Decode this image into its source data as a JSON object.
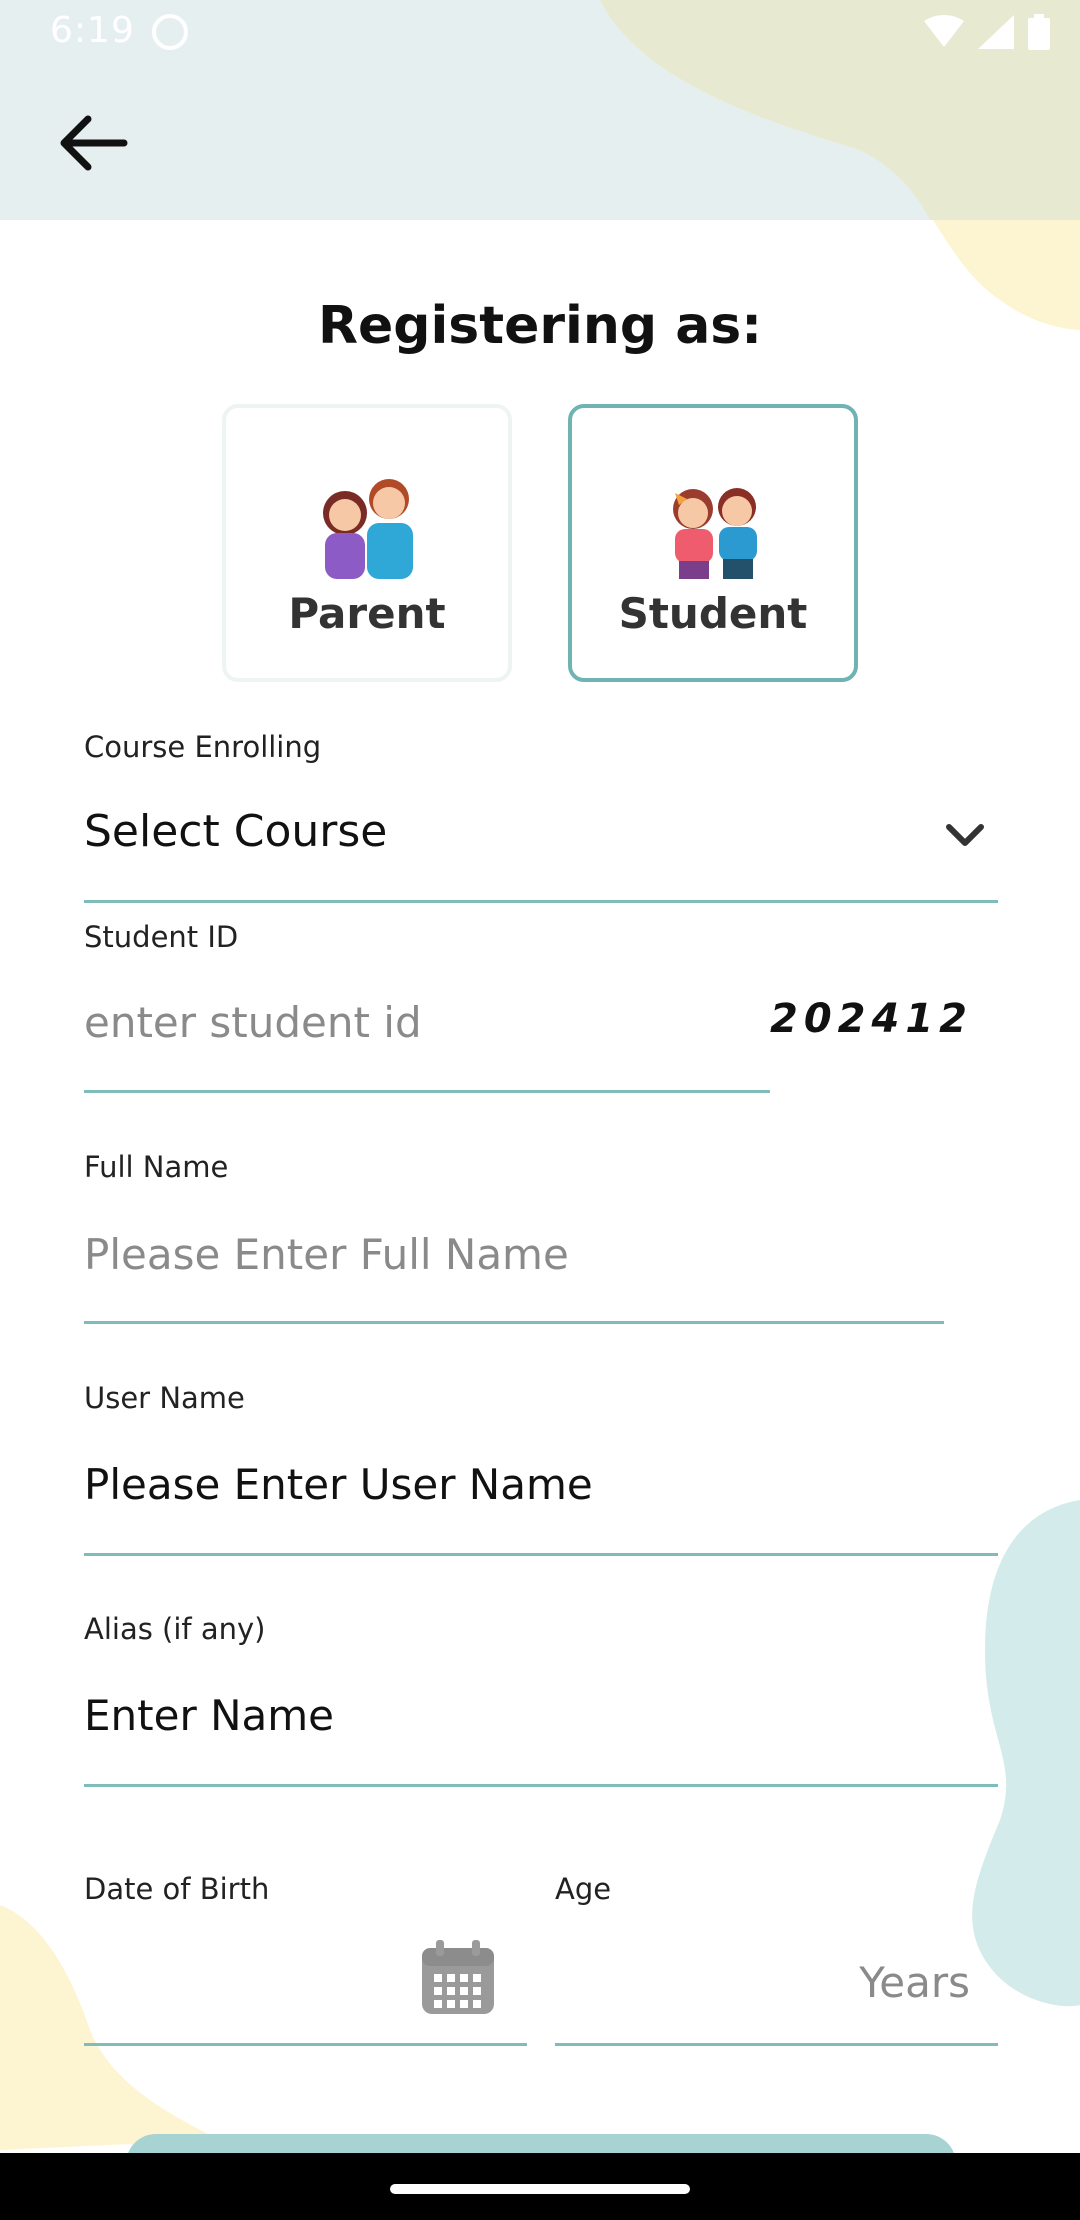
{
  "status_bar": {
    "time": "6:19"
  },
  "header": {
    "back_icon": "arrow-left-icon"
  },
  "title": "Registering as:",
  "roles": [
    {
      "label": "Parent",
      "selected": false
    },
    {
      "label": "Student",
      "selected": true
    }
  ],
  "form": {
    "course": {
      "label": "Course Enrolling",
      "value": "Select Course"
    },
    "student_id": {
      "label": "Student ID",
      "placeholder": "enter student id",
      "code": "202412"
    },
    "full_name": {
      "label": "Full Name",
      "placeholder": "Please Enter Full Name"
    },
    "user_name": {
      "label": "User Name",
      "value": "Please Enter User Name"
    },
    "alias": {
      "label": "Alias (if any)",
      "value": "Enter Name"
    },
    "dob": {
      "label": "Date of Birth",
      "value": ""
    },
    "age": {
      "label": "Age",
      "placeholder": "Years"
    }
  },
  "colors": {
    "accent": "#7fbcbc",
    "selected_border": "#6fb3b3",
    "header_bg": "#e6efef",
    "blob_yellow": "#fdf4d2",
    "blob_teal": "#d3ebeb"
  }
}
